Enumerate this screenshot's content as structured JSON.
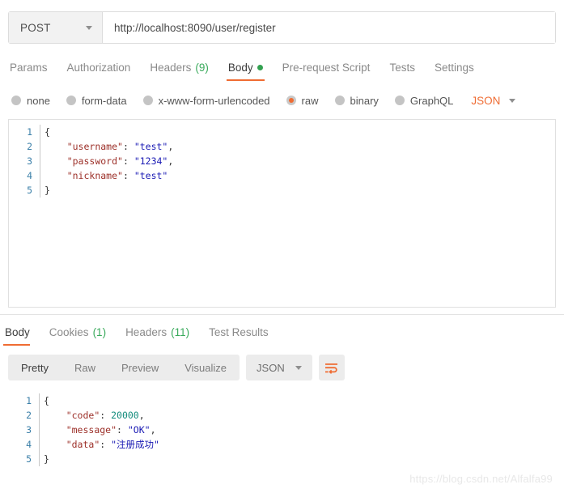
{
  "request": {
    "method": "POST",
    "url": "http://localhost:8090/user/register",
    "tabs": [
      {
        "label": "Params",
        "count": "",
        "active": false
      },
      {
        "label": "Authorization",
        "count": "",
        "active": false
      },
      {
        "label": "Headers",
        "count": "(9)",
        "active": false
      },
      {
        "label": "Body",
        "count": "",
        "active": true,
        "dot": true
      },
      {
        "label": "Pre-request Script",
        "count": "",
        "active": false
      },
      {
        "label": "Tests",
        "count": "",
        "active": false
      },
      {
        "label": "Settings",
        "count": "",
        "active": false
      }
    ],
    "body_types": [
      {
        "label": "none",
        "selected": false
      },
      {
        "label": "form-data",
        "selected": false
      },
      {
        "label": "x-www-form-urlencoded",
        "selected": false
      },
      {
        "label": "raw",
        "selected": true
      },
      {
        "label": "binary",
        "selected": false
      },
      {
        "label": "GraphQL",
        "selected": false
      }
    ],
    "format_dropdown": "JSON",
    "editor": {
      "line_numbers": [
        "1",
        "2",
        "3",
        "4",
        "5"
      ],
      "lines": [
        {
          "text": "{",
          "type": "punct"
        },
        {
          "key": "\"username\"",
          "sep": ": ",
          "value": "\"test\"",
          "tail": ",",
          "type": "string"
        },
        {
          "key": "\"password\"",
          "sep": ": ",
          "value": "\"1234\"",
          "tail": ",",
          "type": "string"
        },
        {
          "key": "\"nickname\"",
          "sep": ": ",
          "value": "\"test\"",
          "tail": "",
          "type": "string"
        },
        {
          "text": "}",
          "type": "punct"
        }
      ]
    }
  },
  "response": {
    "tabs": [
      {
        "label": "Body",
        "count": "",
        "active": true
      },
      {
        "label": "Cookies",
        "count": "(1)",
        "active": false
      },
      {
        "label": "Headers",
        "count": "(11)",
        "active": false
      },
      {
        "label": "Test Results",
        "count": "",
        "active": false
      }
    ],
    "view_modes": [
      {
        "label": "Pretty",
        "active": true
      },
      {
        "label": "Raw",
        "active": false
      },
      {
        "label": "Preview",
        "active": false
      },
      {
        "label": "Visualize",
        "active": false
      }
    ],
    "format_dropdown": "JSON",
    "wrap_icon": "wrap-text-icon",
    "editor": {
      "line_numbers": [
        "1",
        "2",
        "3",
        "4",
        "5"
      ],
      "lines": [
        {
          "text": "{",
          "type": "punct"
        },
        {
          "key": "\"code\"",
          "sep": ": ",
          "value": "20000",
          "tail": ",",
          "type": "number"
        },
        {
          "key": "\"message\"",
          "sep": ": ",
          "value": "\"OK\"",
          "tail": ",",
          "type": "string"
        },
        {
          "key": "\"data\"",
          "sep": ": ",
          "value": "\"注册成功\"",
          "tail": "",
          "type": "string"
        },
        {
          "text": "}",
          "type": "punct"
        }
      ]
    }
  },
  "watermark": "https://blog.csdn.net/Alfalfa99",
  "colors": {
    "accent": "#ef6c33",
    "green": "#33a151",
    "json_key": "#9c2f28",
    "json_string": "#1a1ab4",
    "json_number": "#128c7c",
    "gutter": "#3a7fa8"
  }
}
